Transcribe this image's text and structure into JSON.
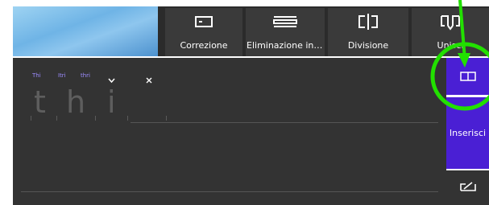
{
  "toolbar": {
    "buttons": [
      {
        "label": "Correzione",
        "icon": "correction-icon"
      },
      {
        "label": "Eliminazione in c..",
        "icon": "strikethrough-delete-icon"
      },
      {
        "label": "Divisione",
        "icon": "split-icon"
      },
      {
        "label": "Unisci",
        "icon": "join-icon"
      }
    ]
  },
  "panel": {
    "suggestions": [
      "Thi",
      "Itri",
      "thri"
    ],
    "glyphs": [
      "t",
      "h",
      "i"
    ],
    "chevron_icon": "chevron-down-icon",
    "close_icon": "close-icon"
  },
  "sidebar": {
    "insert_label": "Inserisci",
    "mode_icon": "keyboard-layout-icon",
    "pen_icon": "handwriting-pen-icon"
  },
  "colors": {
    "accent": "#4a1fd4",
    "annotation": "#22e000",
    "panel": "#333333",
    "toolbar_button": "#3a3a3a",
    "suggestion": "#9d8cff"
  }
}
